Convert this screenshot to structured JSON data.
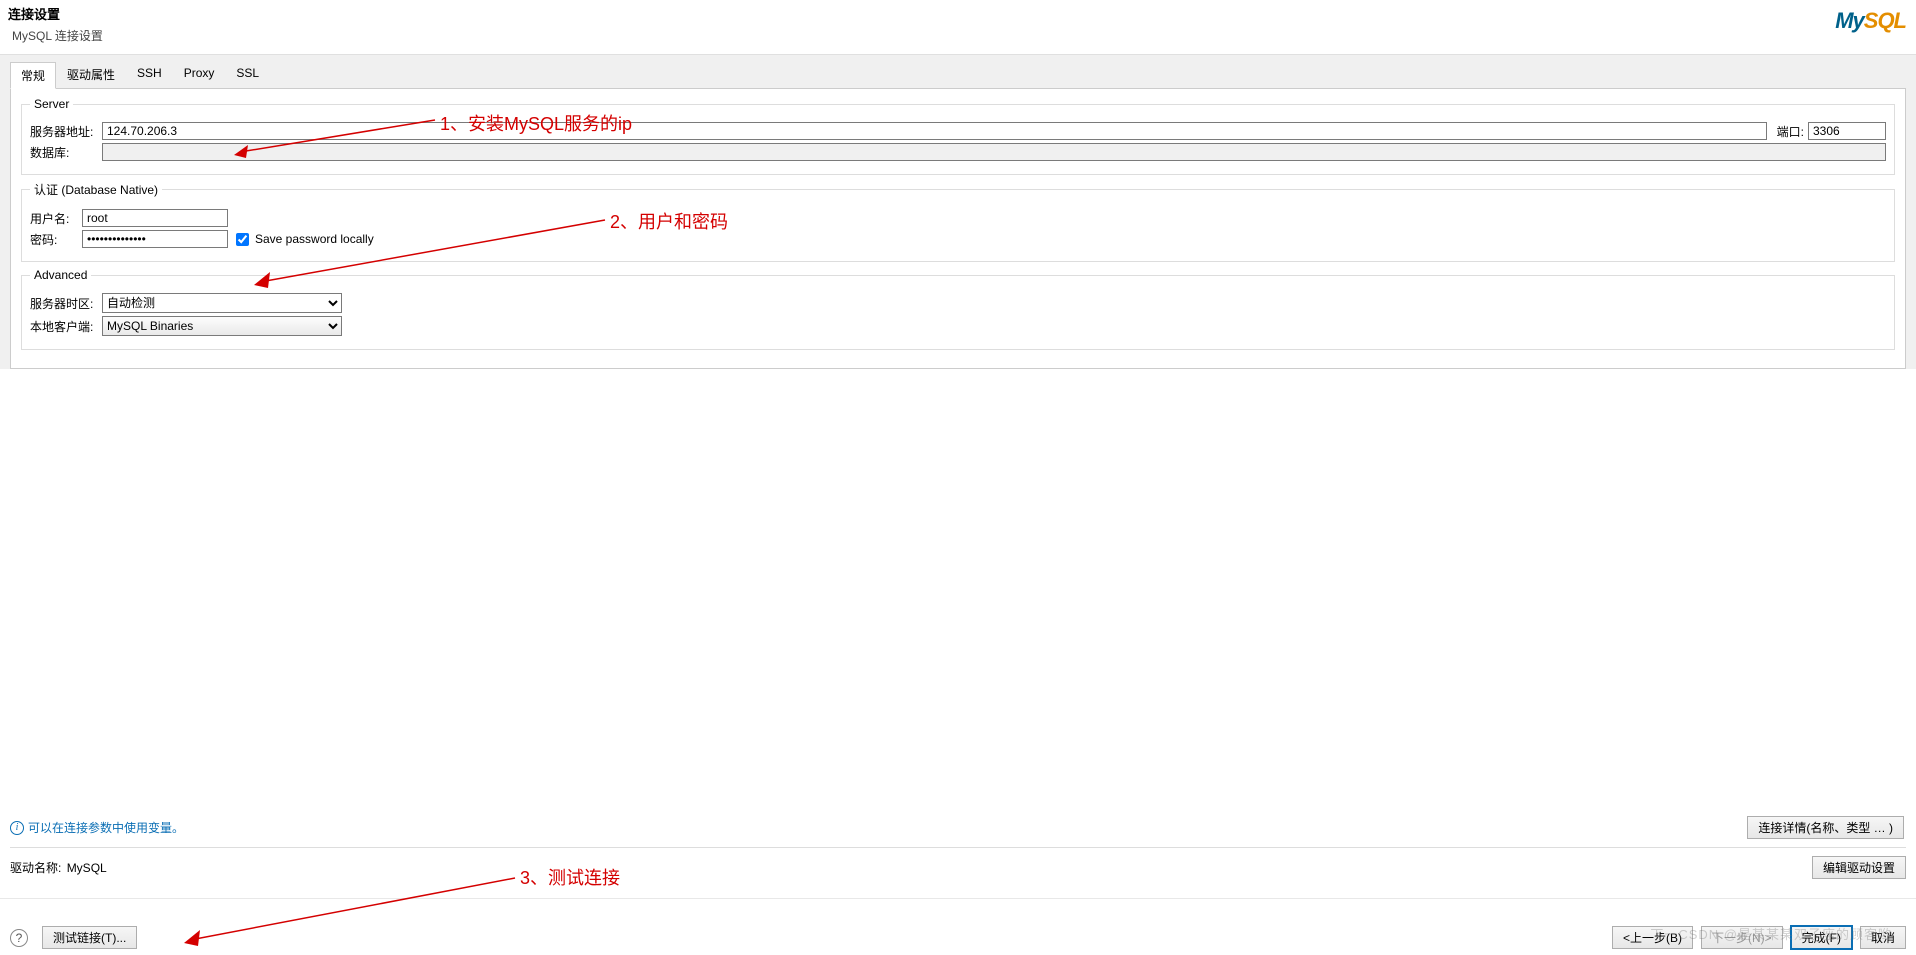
{
  "title": "连接设置",
  "subtitle": "MySQL 连接设置",
  "logo": {
    "my": "My",
    "sql": "SQL"
  },
  "tabs": [
    "常规",
    "驱动属性",
    "SSH",
    "Proxy",
    "SSL"
  ],
  "activeTab": "常规",
  "sections": {
    "server": {
      "legend": "Server",
      "hostLabel": "服务器地址:",
      "hostValue": "124.70.206.3",
      "portLabel": "端口:",
      "portValue": "3306",
      "dbLabel": "数据库:",
      "dbValue": ""
    },
    "auth": {
      "legend": "认证 (Database Native)",
      "userLabel": "用户名:",
      "userValue": "root",
      "pwdLabel": "密码:",
      "pwdValue": "••••••••••••••",
      "savePwdLabel": "Save password locally",
      "savePwdChecked": true
    },
    "advanced": {
      "legend": "Advanced",
      "tzLabel": "服务器时区:",
      "tzValue": "自动检测",
      "clientLabel": "本地客户端:",
      "clientValue": "MySQL Binaries"
    }
  },
  "hint": "可以在连接参数中使用变量。",
  "detailsBtn": "连接详情(名称、类型 … )",
  "driver": {
    "label": "驱动名称:",
    "value": "MySQL",
    "editBtn": "编辑驱动设置"
  },
  "footer": {
    "testBtn": "测试链接(T)...",
    "backBtn": "<上一步(B)",
    "nextBtn": "下一步(N)>",
    "finishBtn": "完成(F)",
    "cancelBtn": "取消"
  },
  "annotations": {
    "a1": "1、安装MySQL服务的ip",
    "a2": "2、用户和密码",
    "a3": "3、测试连接"
  },
  "watermark": "下一CSDN @是某某某双子座的顾客哟"
}
